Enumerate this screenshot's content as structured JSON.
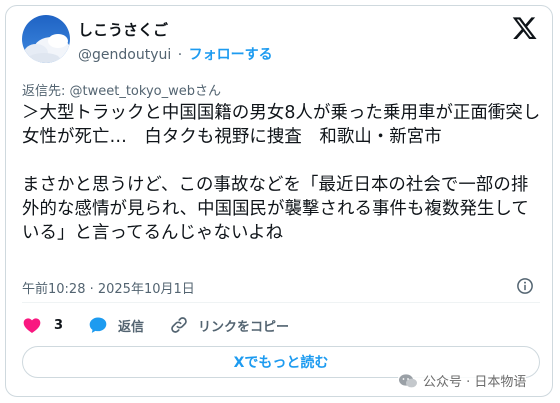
{
  "author": {
    "display_name": "しこうさくご",
    "handle": "@gendoutyui",
    "separator": "·",
    "follow_label": "フォローする"
  },
  "reply_to": "返信先: @tweet_tokyo_webさん",
  "tweet": {
    "text": "＞大型トラックと中国国籍の男女8人が乗った乗用車が正面衝突し女性が死亡…　白タクも視野に捜査　和歌山・新宮市\n\nまさかと思うけど、この事故などを「最近日本の社会で一部の排外的な感情が見られ、中国国民が襲撃される事件も複数発生している」と言ってるんじゃないよね",
    "timestamp": "午前10:28 · 2025年10月1日"
  },
  "actions": {
    "like_count": "3",
    "reply_label": "返信",
    "copy_link_label": "リンクをコピー"
  },
  "read_more_label": "Xでもっと読む",
  "watermark": "公众号 · 日本物语",
  "colors": {
    "accent": "#1d9bf0",
    "like": "#f91880",
    "muted_text": "#536471",
    "border": "#cfd9de"
  },
  "icons": [
    "x-logo-icon",
    "info-icon",
    "heart-icon",
    "reply-bubble-icon",
    "link-icon",
    "wechat-icon"
  ]
}
